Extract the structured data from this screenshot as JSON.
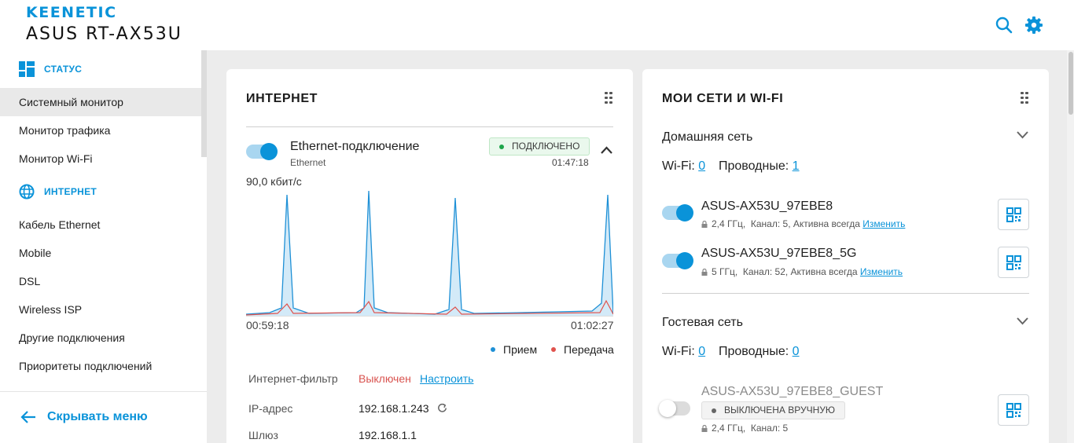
{
  "header": {
    "brand": "KEENETIC",
    "model": "ASUS RT-AX53U",
    "icons": [
      "search-icon",
      "gear-icon"
    ]
  },
  "sidebar": {
    "status_title": "СТАТУС",
    "status_items": [
      "Системный монитор",
      "Монитор трафика",
      "Монитор Wi-Fi"
    ],
    "internet_title": "ИНТЕРНЕТ",
    "internet_items": [
      "Кабель Ethernet",
      "Mobile",
      "DSL",
      "Wireless ISP",
      "Другие подключения",
      "Приоритеты подключений"
    ],
    "collapse_label": "Скрывать меню"
  },
  "internet": {
    "title": "ИНТЕРНЕТ",
    "connection_name": "Ethernet-подключение",
    "connection_type": "Ethernet",
    "status": "ПОДКЛЮЧЕНО",
    "uptime": "01:47:18",
    "speed_label": "90,0 кбит/с",
    "time_start": "00:59:18",
    "time_end": "01:02:27",
    "legend_rx": "Прием",
    "legend_tx": "Передача",
    "filter_label": "Интернет-фильтр",
    "filter_value": "Выключен",
    "filter_link": "Настроить",
    "ip_label": "IP-адрес",
    "ip_value": "192.168.1.243",
    "gateway_label": "Шлюз",
    "gateway_value": "192.168.1.1"
  },
  "networks": {
    "title": "МОИ СЕТИ И WI-FI",
    "home": {
      "title": "Домашняя сеть",
      "wifi_label": "Wi-Fi:",
      "wifi_count": "0",
      "wired_label": "Проводные:",
      "wired_count": "1",
      "ssids": [
        {
          "name": "ASUS-AX53U_97EBE8",
          "band": "2,4 ГГц,",
          "details": "Канал: 5, Активна всегда",
          "edit": "Изменить"
        },
        {
          "name": "ASUS-AX53U_97EBE8_5G",
          "band": "5 ГГц,",
          "details": "Канал: 52, Активна всегда",
          "edit": "Изменить"
        }
      ]
    },
    "guest": {
      "title": "Гостевая сеть",
      "wifi_label": "Wi-Fi:",
      "wifi_count": "0",
      "wired_label": "Проводные:",
      "wired_count": "0",
      "ssid": {
        "name": "ASUS-AX53U_97EBE8_GUEST",
        "status": "ВЫКЛЮЧЕНА ВРУЧНУЮ",
        "band": "2,4 ГГц,",
        "details": "Канал: 5"
      }
    }
  },
  "colors": {
    "accent": "#0a93d9",
    "rx_series": "#1e90d6",
    "tx_series": "#e0524d",
    "connected": "#1ea54a",
    "disabled_text": "#d9534f"
  }
}
